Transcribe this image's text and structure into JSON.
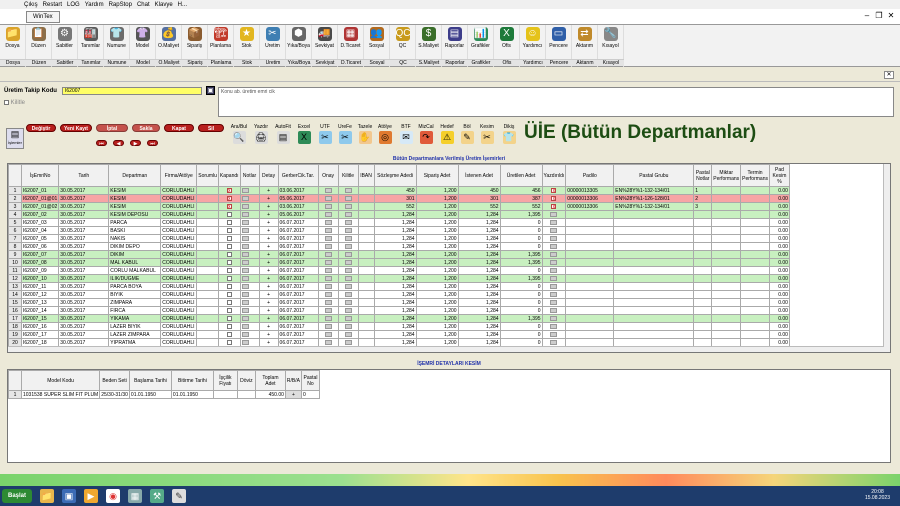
{
  "menu": [
    "Çıkış",
    "Restart",
    "LOG",
    "Yardım",
    "RapStop",
    "Chat",
    "Klavye",
    "H..."
  ],
  "window": {
    "tab": "WinTex",
    "controls": [
      "–",
      "❐",
      "✕"
    ]
  },
  "toolbar": [
    {
      "label": "Dosya",
      "sub": "Dosya",
      "icon": "📁",
      "color": "#d9a42a"
    },
    {
      "label": "Düzen",
      "sub": "Düzen",
      "icon": "📋",
      "color": "#8b6f4a"
    },
    {
      "label": "Sabitler",
      "sub": "Sabitler",
      "icon": "⚙",
      "color": "#777"
    },
    {
      "label": "Tanımlar",
      "sub": "Tanımlar",
      "icon": "🏭",
      "color": "#5a5a5a"
    },
    {
      "label": "Numune",
      "sub": "Numune",
      "icon": "👕",
      "color": "#6b6b6b"
    },
    {
      "label": "Model",
      "sub": "Model",
      "icon": "👚",
      "color": "#555"
    },
    {
      "label": "Ö.Maliyet",
      "sub": "Ö.Maliyet",
      "icon": "💰",
      "color": "#5570a0"
    },
    {
      "label": "Sipariş",
      "sub": "Sipariş",
      "icon": "📦",
      "color": "#8a5b2f"
    },
    {
      "label": "Planlama",
      "sub": "Planlama",
      "icon": "🏗",
      "color": "#c23a2a"
    },
    {
      "label": "Stok",
      "sub": "Stok",
      "icon": "★",
      "color": "#e2b61f"
    },
    {
      "label": "Üretim",
      "sub": "Üretim",
      "icon": "✂",
      "color": "#3f7fb3"
    },
    {
      "label": "Yıka/Boya",
      "sub": "Yıka/Boya",
      "icon": "⬢",
      "color": "#666"
    },
    {
      "label": "Sevkiyat",
      "sub": "Sevkiyat",
      "icon": "🚚",
      "color": "#4a4a4a"
    },
    {
      "label": "D.Ticaret",
      "sub": "D.Ticaret",
      "icon": "▦",
      "color": "#b03535"
    },
    {
      "label": "Sosyal",
      "sub": "Sosyal",
      "icon": "👥",
      "color": "#b36a1e"
    },
    {
      "label": "QC",
      "sub": "QC",
      "icon": "QC",
      "color": "#c99b1d"
    },
    {
      "label": "S.Maliyet",
      "sub": "S.Maliyet",
      "icon": "$",
      "color": "#3a6e2a"
    },
    {
      "label": "Raporlar",
      "sub": "Raporlar",
      "icon": "▤",
      "color": "#3d3d8a"
    },
    {
      "label": "Grafikler",
      "sub": "Grafikler",
      "icon": "📊",
      "color": "#2e8b57"
    },
    {
      "label": "Ofis",
      "sub": "Ofis",
      "icon": "X",
      "color": "#1d7a3a"
    },
    {
      "label": "Yardımcı",
      "sub": "Yardımcı",
      "icon": "☺",
      "color": "#e5c31a"
    },
    {
      "label": "Pencere",
      "sub": "Pencere",
      "icon": "▭",
      "color": "#2f5fa8"
    },
    {
      "label": "Aktarım",
      "sub": "Aktarım",
      "icon": "⇄",
      "color": "#c08a2a"
    },
    {
      "label": "Kısayol",
      "sub": "Kısayol",
      "icon": "🔧",
      "color": "#888"
    }
  ],
  "tracking": {
    "label": "Üretim Takip Kodu",
    "value": "I62007",
    "lock_label": "Kilitle",
    "note_placeholder": "Konu ab. üretim emri cik"
  },
  "buttons": {
    "islemler": "İşlemler",
    "degistir": "Değiştir",
    "yeni_kayit": "Yeni Kayıt",
    "iptal": "İptal",
    "sakla": "Sakla",
    "kapat": "Kapat",
    "sil": "Sil"
  },
  "side_buttons": [
    {
      "label": "Ara/Bul",
      "icon": "🔍",
      "color": "#dcdcdc"
    },
    {
      "label": "Yazdır",
      "icon": "🖨",
      "color": "#dcdcdc"
    },
    {
      "label": "AutoFit",
      "icon": "▤",
      "color": "#dcdcdc"
    },
    {
      "label": "Excel",
      "icon": "X",
      "color": "#2e8b57"
    },
    {
      "label": "UTF",
      "icon": "✂",
      "color": "#8ec9ec"
    },
    {
      "label": "UreFe",
      "icon": "✂",
      "color": "#8ec9ec"
    },
    {
      "label": "Tazele",
      "icon": "✋",
      "color": "#f2c88f"
    },
    {
      "label": "Atölye",
      "icon": "◎",
      "color": "#e07a2f"
    },
    {
      "label": "BTF",
      "icon": "✉",
      "color": "#d6e9f7"
    },
    {
      "label": "MizCal",
      "icon": "↷",
      "color": "#e05a3a"
    },
    {
      "label": "Hedef",
      "icon": "⚠",
      "color": "#f5cf2a"
    },
    {
      "label": "Böl",
      "icon": "✎",
      "color": "#f3d38a"
    },
    {
      "label": "Kesim",
      "icon": "✂",
      "color": "#f3d38a"
    },
    {
      "label": "Dikiş",
      "icon": "👕",
      "color": "#f3d38a"
    }
  ],
  "title": "ÜİE  (Bütün Departmanlar)",
  "main_caption": "Bütün Departmanlara Verilmiş Üretim İşemirleri",
  "main_headers": [
    "",
    "İşEmriNo",
    "Tarih",
    "Departman",
    "Firma/Atölye",
    "Sorumlu",
    "Kapandı",
    "Notlar",
    "Detay",
    "GerberCik.Tar.",
    "Onay",
    "Kilitle",
    "IBAN",
    "Sözleşme Adedi",
    "Sipariş Adet",
    "İstenen Adet",
    "Üretilen Adet",
    "Yazdırıldı",
    "Padilo",
    "Pastal Grubu",
    "Pastal Notlar",
    "Miktar Performans",
    "Termin Performans",
    "Pad Kesim %"
  ],
  "rows": [
    {
      "n": "1",
      "id": "I62007_01",
      "date": "30.05.2017",
      "dept": "KESIM",
      "firm": "CORLUDAHLI",
      "kap": "x",
      "det": "+",
      "gerber": "03.06.2017",
      "soz": "450",
      "sip": "1,200",
      "ist": "450",
      "ure": "456",
      "yaz": "x",
      "padilo": "00000013305",
      "pg": "EN%28Y%1-132-134/01",
      "pn": "1",
      "pad": "0.00",
      "cls": "rg"
    },
    {
      "n": "2",
      "id": "I62007_01@01",
      "date": "30.05.2017",
      "dept": "KESIM",
      "firm": "CORLUDAHLI",
      "kap": "x",
      "det": "+",
      "gerber": "05.06.2017",
      "soz": "301",
      "sip": "1,200",
      "ist": "301",
      "ure": "387",
      "yaz": "x",
      "padilo": "00000013306",
      "pg": "EN%28Y%1-126-128/01",
      "pn": "2",
      "pad": "0.00",
      "cls": "rsel"
    },
    {
      "n": "3",
      "id": "I62007_01@02",
      "date": "30.05.2017",
      "dept": "KESIM",
      "firm": "CORLUDAHLI",
      "kap": "x",
      "det": "+",
      "gerber": "03.06.2017",
      "soz": "552",
      "sip": "1,200",
      "ist": "552",
      "ure": "552",
      "yaz": "x",
      "padilo": "00000013306",
      "pg": "EN%28Y%1-132-134/01",
      "pn": "3",
      "pad": "0.00",
      "cls": "rg"
    },
    {
      "n": "4",
      "id": "I62007_02",
      "date": "30.05.2017",
      "dept": "KESIM DEPOSU",
      "firm": "CORLUDAHLI",
      "kap": "",
      "det": "+",
      "gerber": "05.06.2017",
      "soz": "1,284",
      "sip": "1,200",
      "ist": "1,284",
      "ure": "1,395",
      "yaz": "",
      "padilo": "",
      "pg": "",
      "pn": "",
      "pad": "0.00",
      "cls": "rg"
    },
    {
      "n": "5",
      "id": "I62007_03",
      "date": "30.05.2017",
      "dept": "PARCA",
      "firm": "CORLUDAHLI",
      "kap": "",
      "det": "+",
      "gerber": "06.07.2017",
      "soz": "1,284",
      "sip": "1,200",
      "ist": "1,284",
      "ure": "0",
      "yaz": "",
      "padilo": "",
      "pg": "",
      "pn": "",
      "pad": "0.00",
      "cls": "rw"
    },
    {
      "n": "6",
      "id": "I62007_04",
      "date": "30.05.2017",
      "dept": "BASKI",
      "firm": "CORLUDAHLI",
      "kap": "",
      "det": "+",
      "gerber": "06.07.2017",
      "soz": "1,284",
      "sip": "1,200",
      "ist": "1,284",
      "ure": "0",
      "yaz": "",
      "padilo": "",
      "pg": "",
      "pn": "",
      "pad": "0.00",
      "cls": "rw"
    },
    {
      "n": "7",
      "id": "I62007_05",
      "date": "30.05.2017",
      "dept": "NAKIS",
      "firm": "CORLUDAHLI",
      "kap": "",
      "det": "+",
      "gerber": "06.07.2017",
      "soz": "1,284",
      "sip": "1,200",
      "ist": "1,284",
      "ure": "0",
      "yaz": "",
      "padilo": "",
      "pg": "",
      "pn": "",
      "pad": "0.00",
      "cls": "rw"
    },
    {
      "n": "8",
      "id": "I62007_06",
      "date": "30.05.2017",
      "dept": "DIKIM DEPO",
      "firm": "CORLUDAHLI",
      "kap": "",
      "det": "+",
      "gerber": "06.07.2017",
      "soz": "1,284",
      "sip": "1,200",
      "ist": "1,284",
      "ure": "0",
      "yaz": "",
      "padilo": "",
      "pg": "",
      "pn": "",
      "pad": "0.00",
      "cls": "rw"
    },
    {
      "n": "9",
      "id": "I62007_07",
      "date": "30.05.2017",
      "dept": "DIKIM",
      "firm": "CORLUDAHLI",
      "kap": "",
      "det": "+",
      "gerber": "06.07.2017",
      "soz": "1,284",
      "sip": "1,200",
      "ist": "1,284",
      "ure": "1,395",
      "yaz": "",
      "padilo": "",
      "pg": "",
      "pn": "",
      "pad": "0.00",
      "cls": "rg"
    },
    {
      "n": "10",
      "id": "I62007_08",
      "date": "30.05.2017",
      "dept": "MAL KABUL",
      "firm": "CORLUDAHLI",
      "kap": "",
      "det": "+",
      "gerber": "06.07.2017",
      "soz": "1,284",
      "sip": "1,200",
      "ist": "1,284",
      "ure": "1,395",
      "yaz": "",
      "padilo": "",
      "pg": "",
      "pn": "",
      "pad": "0.00",
      "cls": "rg"
    },
    {
      "n": "11",
      "id": "I62007_09",
      "date": "30.05.2017",
      "dept": "CORLU MALKABUL",
      "firm": "CORLUDAHLI",
      "kap": "",
      "det": "+",
      "gerber": "06.07.2017",
      "soz": "1,284",
      "sip": "1,200",
      "ist": "1,284",
      "ure": "0",
      "yaz": "",
      "padilo": "",
      "pg": "",
      "pn": "",
      "pad": "0.00",
      "cls": "rw"
    },
    {
      "n": "12",
      "id": "I62007_10",
      "date": "30.05.2017",
      "dept": "ILIK/DUGME",
      "firm": "CORLUDAHLI",
      "kap": "",
      "det": "+",
      "gerber": "06.07.2017",
      "soz": "1,284",
      "sip": "1,200",
      "ist": "1,284",
      "ure": "1,395",
      "yaz": "",
      "padilo": "",
      "pg": "",
      "pn": "",
      "pad": "0.00",
      "cls": "rg"
    },
    {
      "n": "13",
      "id": "I62007_11",
      "date": "30.05.2017",
      "dept": "PARCA BOYA",
      "firm": "CORLUDAHLI",
      "kap": "",
      "det": "+",
      "gerber": "06.07.2017",
      "soz": "1,284",
      "sip": "1,200",
      "ist": "1,284",
      "ure": "0",
      "yaz": "",
      "padilo": "",
      "pg": "",
      "pn": "",
      "pad": "0.00",
      "cls": "rw"
    },
    {
      "n": "14",
      "id": "I62007_12",
      "date": "30.05.2017",
      "dept": "BIYIK",
      "firm": "CORLUDAHLI",
      "kap": "",
      "det": "+",
      "gerber": "06.07.2017",
      "soz": "1,284",
      "sip": "1,200",
      "ist": "1,284",
      "ure": "0",
      "yaz": "",
      "padilo": "",
      "pg": "",
      "pn": "",
      "pad": "0.00",
      "cls": "rw"
    },
    {
      "n": "15",
      "id": "I62007_13",
      "date": "30.05.2017",
      "dept": "ZIMPARA",
      "firm": "CORLUDAHLI",
      "kap": "",
      "det": "+",
      "gerber": "06.07.2017",
      "soz": "1,284",
      "sip": "1,200",
      "ist": "1,284",
      "ure": "0",
      "yaz": "",
      "padilo": "",
      "pg": "",
      "pn": "",
      "pad": "0.00",
      "cls": "rw"
    },
    {
      "n": "16",
      "id": "I62007_14",
      "date": "30.05.2017",
      "dept": "FIRCA",
      "firm": "CORLUDAHLI",
      "kap": "",
      "det": "+",
      "gerber": "06.07.2017",
      "soz": "1,284",
      "sip": "1,200",
      "ist": "1,284",
      "ure": "0",
      "yaz": "",
      "padilo": "",
      "pg": "",
      "pn": "",
      "pad": "0.00",
      "cls": "rw"
    },
    {
      "n": "17",
      "id": "I62007_15",
      "date": "30.05.2017",
      "dept": "YIKAMA",
      "firm": "CORLUDAHLI",
      "kap": "",
      "det": "+",
      "gerber": "06.07.2017",
      "soz": "1,284",
      "sip": "1,200",
      "ist": "1,284",
      "ure": "1,395",
      "yaz": "",
      "padilo": "",
      "pg": "",
      "pn": "",
      "pad": "0.00",
      "cls": "rg"
    },
    {
      "n": "18",
      "id": "I62007_16",
      "date": "30.05.2017",
      "dept": "LAZER BIYIK",
      "firm": "CORLUDAHLI",
      "kap": "",
      "det": "+",
      "gerber": "06.07.2017",
      "soz": "1,284",
      "sip": "1,200",
      "ist": "1,284",
      "ure": "0",
      "yaz": "",
      "padilo": "",
      "pg": "",
      "pn": "",
      "pad": "0.00",
      "cls": "rw"
    },
    {
      "n": "19",
      "id": "I62007_17",
      "date": "30.05.2017",
      "dept": "LAZER ZIMPARA",
      "firm": "CORLUDAHLI",
      "kap": "",
      "det": "+",
      "gerber": "06.07.2017",
      "soz": "1,284",
      "sip": "1,200",
      "ist": "1,284",
      "ure": "0",
      "yaz": "",
      "padilo": "",
      "pg": "",
      "pn": "",
      "pad": "0.00",
      "cls": "rw"
    },
    {
      "n": "20",
      "id": "I62007_18",
      "date": "30.05.2017",
      "dept": "YIPRATMA",
      "firm": "CORLUDAHLI",
      "kap": "",
      "det": "+",
      "gerber": "06.07.2017",
      "soz": "1,284",
      "sip": "1,200",
      "ist": "1,284",
      "ure": "0",
      "yaz": "",
      "padilo": "",
      "pg": "",
      "pn": "",
      "pad": "0.00",
      "cls": "rw"
    }
  ],
  "detail_caption": "İŞEMRİ DETAYLARI KESİM",
  "detail_headers": [
    "",
    "Model Kodu",
    "Beden Seti",
    "Başlama Tarihi",
    "Bitirme Tarihi",
    "İşçilik Fiyatı",
    "Döviz",
    "Toplam Adet",
    "R/B/A",
    "Pastal No"
  ],
  "detail_rows": [
    {
      "n": "1",
      "model": "1031538 SUPER SLIM FIT PLUM",
      "beden": "25/30-31/30",
      "bas": "01.01.1950",
      "bit": "01.01.1950",
      "fiyat": "",
      "doviz": "",
      "adet": "450.00",
      "rba": "+",
      "pastal": "0"
    }
  ],
  "taskbar": {
    "start": "Başlat",
    "clock_time": "20:08",
    "clock_date": "15.08.2023"
  }
}
